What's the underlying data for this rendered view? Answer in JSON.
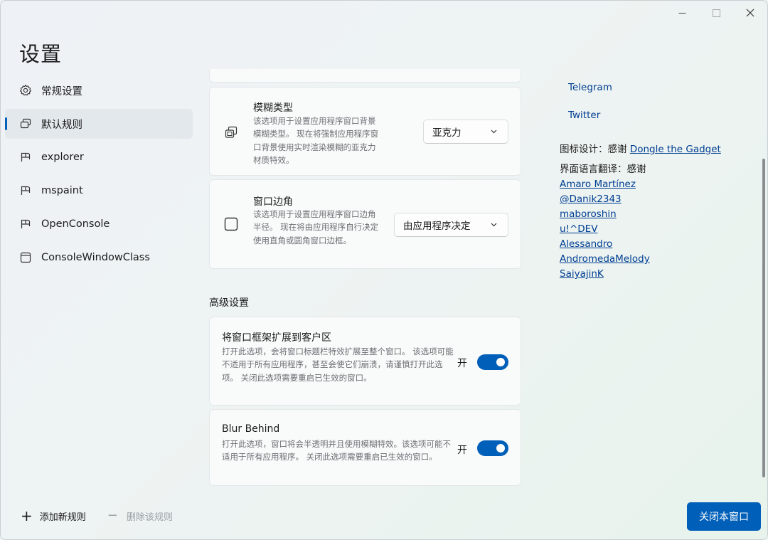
{
  "app": {
    "title": "设置"
  },
  "sidebar": {
    "items": [
      {
        "label": "常规设置",
        "icon": "gear-icon",
        "active": false
      },
      {
        "label": "默认规则",
        "icon": "copy-windows-icon",
        "active": true
      },
      {
        "label": "explorer",
        "icon": "app-rule-icon",
        "active": false
      },
      {
        "label": "mspaint",
        "icon": "app-rule-icon",
        "active": false
      },
      {
        "label": "OpenConsole",
        "icon": "app-rule-icon",
        "active": false
      },
      {
        "label": "ConsoleWindowClass",
        "icon": "window-class-icon",
        "active": false
      }
    ],
    "add_rule_label": "添加新规则",
    "delete_rule_label": "删除该规则"
  },
  "settings": {
    "blur_type": {
      "title": "模糊类型",
      "description": "该选项用于设置应用程序窗口背景模糊类型。 现在将强制应用程序窗口背景使用实时渲染模糊的亚克力材质特效。",
      "value": "亚克力"
    },
    "window_corner": {
      "title": "窗口边角",
      "description": "该选项用于设置应用程序窗口边角半径。 现在将由应用程序自行决定使用直角或圆角窗口边框。",
      "value": "由应用程序决定"
    },
    "advanced_header": "高级设置",
    "extend_frame": {
      "title": "将窗口框架扩展到客户区",
      "description": "打开此选项，会将窗口标题栏特效扩展至整个窗口。 该选项可能不适用于所有应用程序，甚至会使它们崩溃，请谨慎打开此选项。 关闭此选项需要重启已生效的窗口。",
      "toggle_label": "开",
      "on": true
    },
    "blur_behind": {
      "title": "Blur Behind",
      "description": "打开此选项，窗口将会半透明并且使用模糊特效。该选项可能不适用于所有应用程序。 关闭此选项需要重启已生效的窗口。",
      "toggle_label": "开",
      "on": true
    }
  },
  "about": {
    "links": [
      "Telegram",
      "Twitter"
    ],
    "icon_credit_prefix": "图标设计：感谢 ",
    "icon_credit_name": "Dongle the Gadget",
    "translation_credit": "界面语言翻译：感谢",
    "translators": [
      "Amaro Martínez",
      "@Danik2343",
      "maboroshin",
      "u!^DEV",
      "Alessandro",
      "AndromedaMelody",
      "SaiyajinK"
    ]
  },
  "footer": {
    "close_label": "关闭本窗口"
  },
  "colors": {
    "accent": "#005fb8",
    "link": "#003e92"
  }
}
